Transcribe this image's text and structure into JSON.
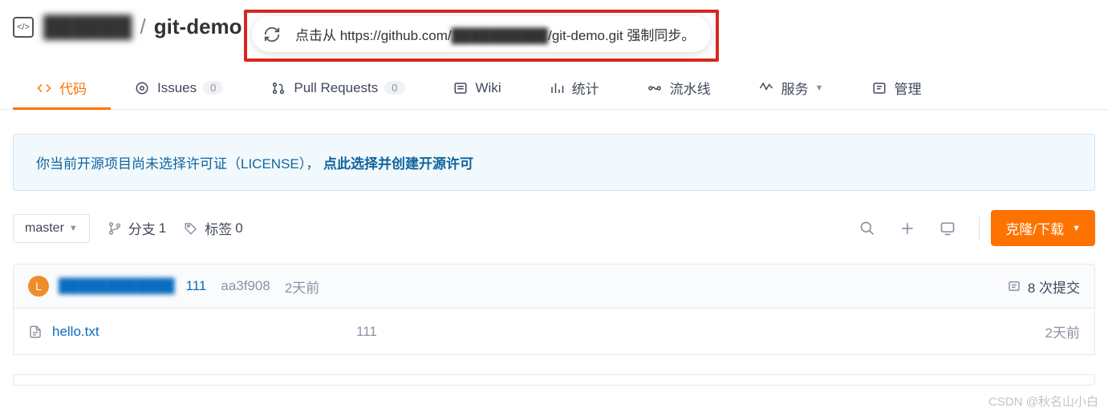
{
  "header": {
    "owner_redacted": "██████",
    "separator": "/",
    "repo_name": "git-demo"
  },
  "popover": {
    "text_before": "点击从 https://github.com/",
    "text_redacted": "██████████",
    "text_after": "/git-demo.git 强制同步。"
  },
  "tabs": {
    "code": "代码",
    "issues": "Issues",
    "issues_count": "0",
    "pr": "Pull Requests",
    "pr_count": "0",
    "wiki": "Wiki",
    "stats": "统计",
    "pipeline": "流水线",
    "services": "服务",
    "manage": "管理"
  },
  "license": {
    "prefix": "你当前开源项目尚未选择许可证（LICENSE），",
    "link": "点此选择并创建开源许可"
  },
  "toolbar": {
    "branch_selected": "master",
    "branches_label": "分支",
    "branches_count": "1",
    "tags_label": "标签",
    "tags_count": "0",
    "clone_label": "克隆/下载"
  },
  "latest_commit": {
    "avatar_letter": "L",
    "author_redacted": "████████████",
    "message": "111",
    "sha": "aa3f908",
    "time": "2天前",
    "commits_count_label": "8 次提交"
  },
  "files": [
    {
      "name": "hello.txt",
      "message": "111",
      "time": "2天前"
    }
  ],
  "watermark": "CSDN @秋名山小白"
}
